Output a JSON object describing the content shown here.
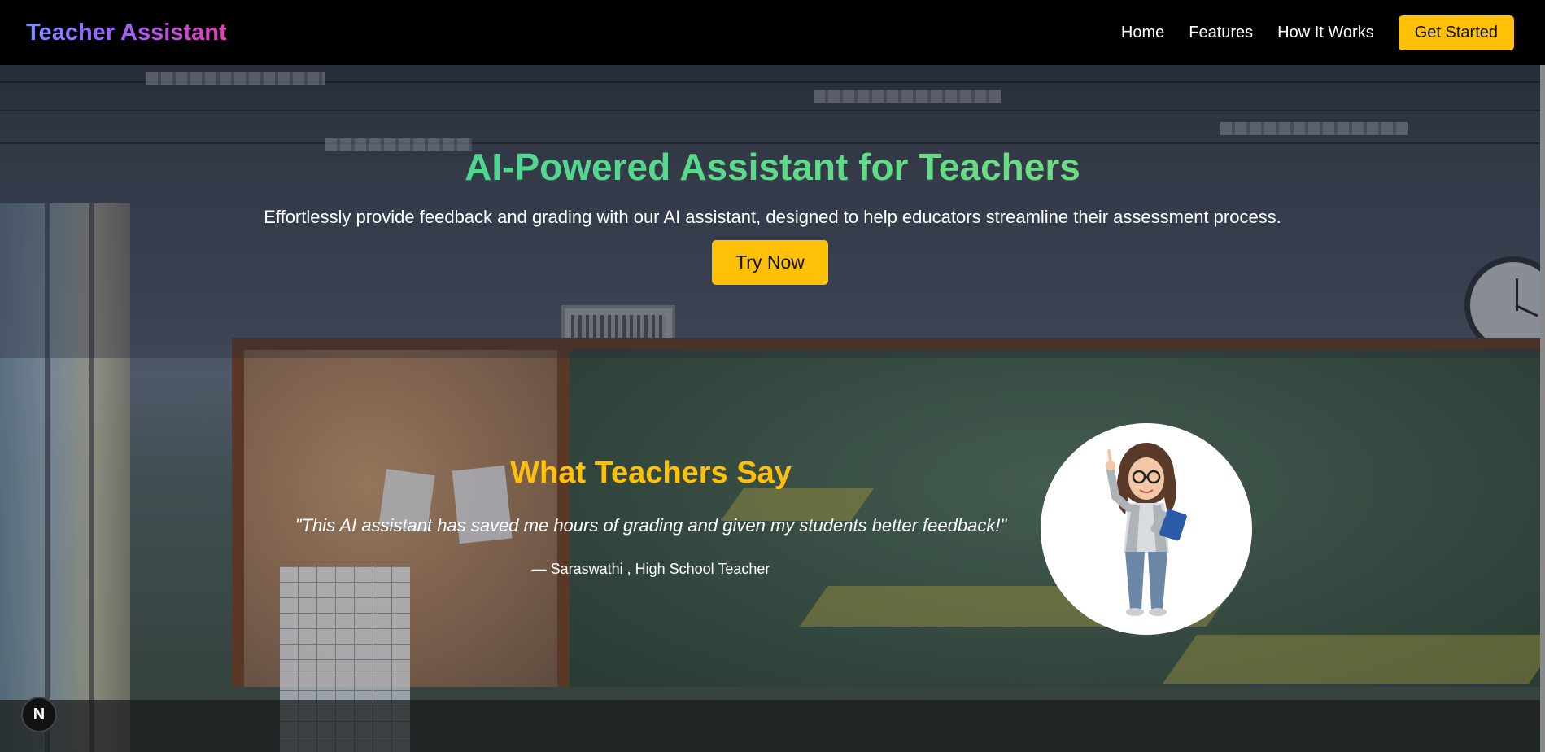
{
  "navbar": {
    "brand": "Teacher Assistant",
    "links": [
      "Home",
      "Features",
      "How It Works"
    ],
    "cta": "Get Started"
  },
  "hero": {
    "title": "AI-Powered Assistant for Teachers",
    "subtitle": "Effortlessly provide feedback and grading with our AI assistant, designed to help educators streamline their assessment process.",
    "button": "Try Now"
  },
  "testimonial": {
    "heading": "What Teachers Say",
    "quote": "\"This AI assistant has saved me hours of grading and given my students better feedback!\"",
    "author": "— Saraswathi , High School Teacher"
  },
  "badge": {
    "label": "N"
  },
  "colors": {
    "accent": "#ffc107",
    "title_gradient": "#34d399",
    "brand_gradient_start": "#7b8cff",
    "brand_gradient_end": "#e63fb3"
  }
}
